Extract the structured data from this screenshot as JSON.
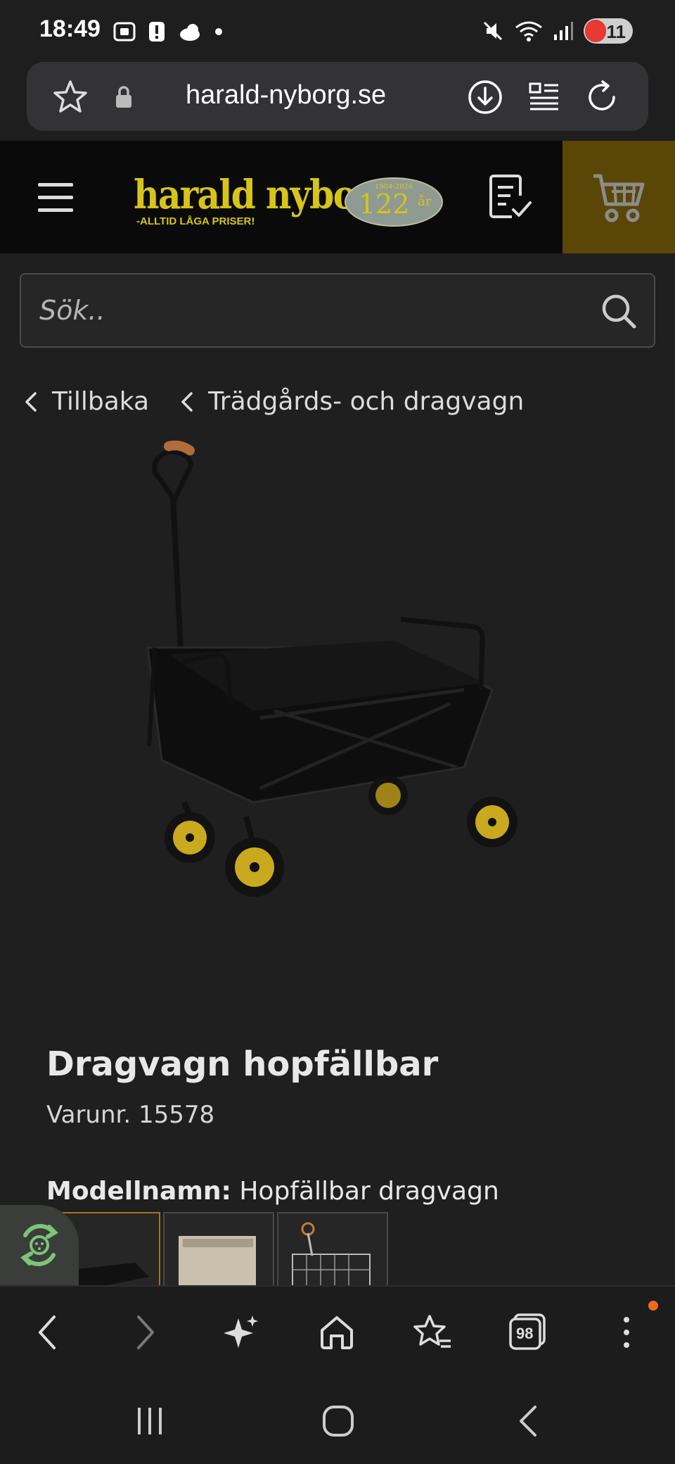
{
  "status_bar": {
    "time": "18:49",
    "battery": "11"
  },
  "browser": {
    "url": "harald-nyborg.se",
    "tab_count": "98"
  },
  "header": {
    "logo_text": "harald nyborg",
    "logo_tagline": "-ALLTID LÅGA PRISER!",
    "badge_years": "1904-2026",
    "badge_number": "122",
    "badge_unit": "år",
    "accent": "#d6c41a",
    "cart_bg": "#5a4606"
  },
  "search": {
    "placeholder": "Sök.."
  },
  "breadcrumbs": [
    {
      "label": "Tillbaka"
    },
    {
      "label": "Trädgårds- och dragvagn"
    }
  ],
  "product": {
    "title": "Dragvagn hopfällbar",
    "sku": "Varunr. 15578",
    "model_label": "Modellnamn:",
    "model_value": "Hopfällbar dragvagn"
  }
}
